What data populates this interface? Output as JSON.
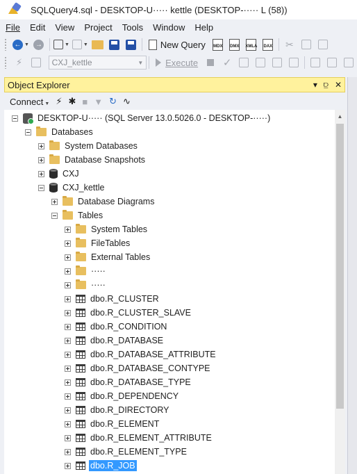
{
  "window": {
    "title": "SQLQuery4.sql - DESKTOP-U····· kettle (DESKTOP-····· L (58))"
  },
  "menu": [
    "File",
    "Edit",
    "View",
    "Project",
    "Tools",
    "Window",
    "Help"
  ],
  "toolbar": {
    "new_query_label": "New Query",
    "query_types": [
      "MDX",
      "DMX",
      "XMLA",
      "DAX"
    ],
    "database_selected": "CXJ_kettle",
    "execute_label": "Execute"
  },
  "object_explorer": {
    "title": "Object Explorer",
    "header_icons": {
      "dropdown": "▾",
      "pin": "⫒",
      "close": "✕"
    },
    "connect_label": "Connect",
    "tree": [
      {
        "id": "server",
        "depth": 0,
        "expander": "minus",
        "icon": "server-icon",
        "label": "DESKTOP-U····· (SQL Server 13.0.5026.0 - DESKTOP-·····)"
      },
      {
        "id": "databases",
        "depth": 1,
        "expander": "minus",
        "icon": "folder-icon",
        "label": "Databases"
      },
      {
        "id": "system-databases",
        "depth": 2,
        "expander": "plus",
        "icon": "folder-icon",
        "label": "System Databases"
      },
      {
        "id": "database-snapshots",
        "depth": 2,
        "expander": "plus",
        "icon": "folder-icon",
        "label": "Database Snapshots"
      },
      {
        "id": "db-cxj",
        "depth": 2,
        "expander": "plus",
        "icon": "database-icon",
        "label": "CXJ"
      },
      {
        "id": "db-cxj-kettle",
        "depth": 2,
        "expander": "minus",
        "icon": "database-icon",
        "label": "CXJ_kettle"
      },
      {
        "id": "database-diagrams",
        "depth": 3,
        "expander": "plus",
        "icon": "folder-icon",
        "label": "Database Diagrams"
      },
      {
        "id": "tables",
        "depth": 3,
        "expander": "minus",
        "icon": "folder-icon",
        "label": "Tables"
      },
      {
        "id": "system-tables",
        "depth": 4,
        "expander": "plus",
        "icon": "folder-icon",
        "label": "System Tables"
      },
      {
        "id": "filetables",
        "depth": 4,
        "expander": "plus",
        "icon": "folder-icon",
        "label": "FileTables"
      },
      {
        "id": "external-tables",
        "depth": 4,
        "expander": "plus",
        "icon": "folder-icon",
        "label": "External Tables"
      },
      {
        "id": "graph-tables",
        "depth": 4,
        "expander": "plus",
        "icon": "folder-icon",
        "label": "·····"
      },
      {
        "id": "dropped-ledger-tables",
        "depth": 4,
        "expander": "plus",
        "icon": "folder-icon",
        "label": "·····"
      },
      {
        "id": "t-cluster",
        "depth": 4,
        "expander": "plus",
        "icon": "table-icon",
        "label": "dbo.R_CLUSTER"
      },
      {
        "id": "t-cluster-slave",
        "depth": 4,
        "expander": "plus",
        "icon": "table-icon",
        "label": "dbo.R_CLUSTER_SLAVE"
      },
      {
        "id": "t-condition",
        "depth": 4,
        "expander": "plus",
        "icon": "table-icon",
        "label": "dbo.R_CONDITION"
      },
      {
        "id": "t-database",
        "depth": 4,
        "expander": "plus",
        "icon": "table-icon",
        "label": "dbo.R_DATABASE"
      },
      {
        "id": "t-database-attribute",
        "depth": 4,
        "expander": "plus",
        "icon": "table-icon",
        "label": "dbo.R_DATABASE_ATTRIBUTE"
      },
      {
        "id": "t-database-contype",
        "depth": 4,
        "expander": "plus",
        "icon": "table-icon",
        "label": "dbo.R_DATABASE_CONTYPE"
      },
      {
        "id": "t-database-type",
        "depth": 4,
        "expander": "plus",
        "icon": "table-icon",
        "label": "dbo.R_DATABASE_TYPE"
      },
      {
        "id": "t-dependency",
        "depth": 4,
        "expander": "plus",
        "icon": "table-icon",
        "label": "dbo.R_DEPENDENCY"
      },
      {
        "id": "t-directory",
        "depth": 4,
        "expander": "plus",
        "icon": "table-icon",
        "label": "dbo.R_DIRECTORY"
      },
      {
        "id": "t-element",
        "depth": 4,
        "expander": "plus",
        "icon": "table-icon",
        "label": "dbo.R_ELEMENT"
      },
      {
        "id": "t-element-attribute",
        "depth": 4,
        "expander": "plus",
        "icon": "table-icon",
        "label": "dbo.R_ELEMENT_ATTRIBUTE"
      },
      {
        "id": "t-element-type",
        "depth": 4,
        "expander": "plus",
        "icon": "table-icon",
        "label": "dbo.R_ELEMENT_TYPE"
      },
      {
        "id": "t-job",
        "depth": 4,
        "expander": "plus",
        "icon": "table-icon",
        "label": "dbo.R_JOB",
        "selected": true
      }
    ]
  },
  "colors": {
    "panel_header": "#fff29d",
    "selection": "#3399ff",
    "folder": "#e8bf5f"
  }
}
